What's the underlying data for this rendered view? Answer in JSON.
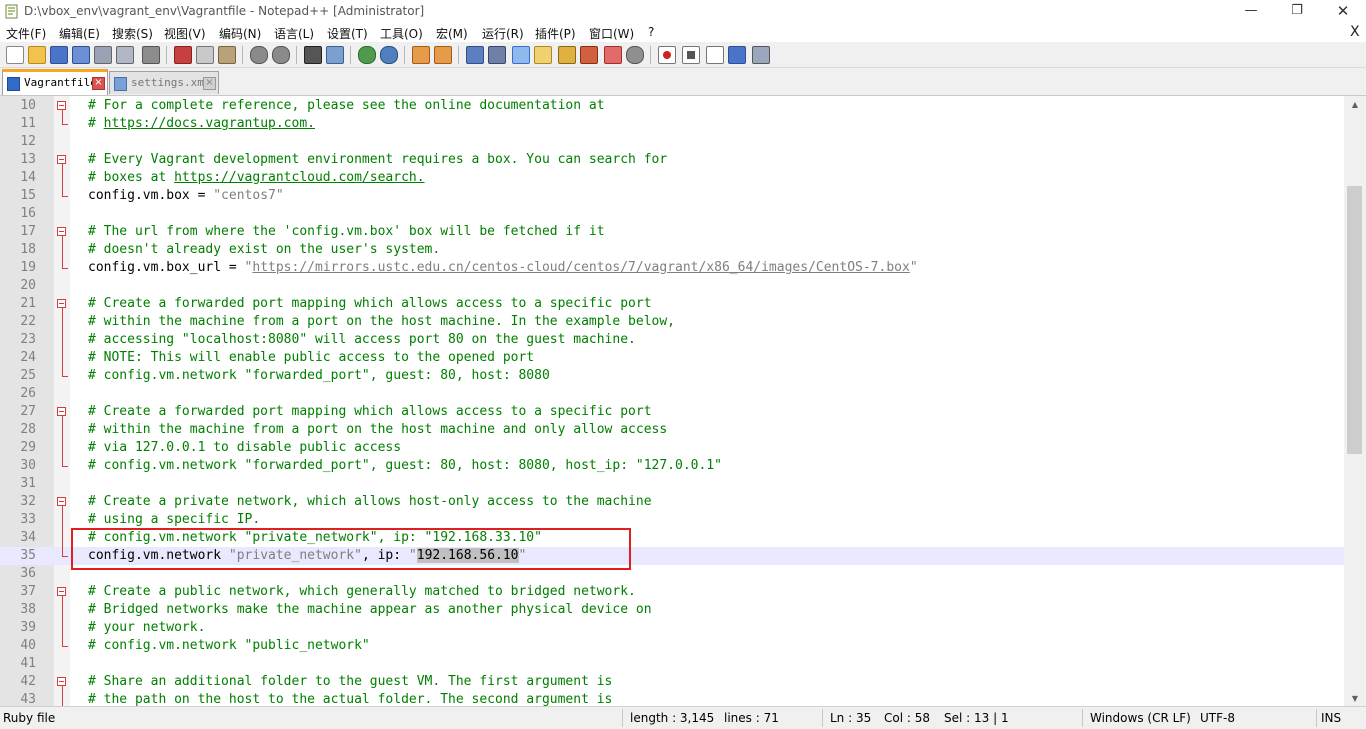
{
  "window": {
    "title": "D:\\vbox_env\\vagrant_env\\Vagrantfile - Notepad++ [Administrator]",
    "minimize_glyph": "—",
    "maximize_glyph": "❐",
    "close_glyph": "✕"
  },
  "menu": {
    "items": [
      "文件(F)",
      "编辑(E)",
      "搜索(S)",
      "视图(V)",
      "编码(N)",
      "语言(L)",
      "设置(T)",
      "工具(O)",
      "宏(M)",
      "运行(R)",
      "插件(P)",
      "窗口(W)",
      "?"
    ],
    "close_doc_glyph": "X"
  },
  "toolbar": {
    "icons": [
      "new-file-icon",
      "open-file-icon",
      "save-icon",
      "save-all-icon",
      "close-icon",
      "close-all-icon",
      "print-icon",
      "cut-icon",
      "copy-icon",
      "paste-icon",
      "undo-icon",
      "redo-icon",
      "find-icon",
      "replace-icon",
      "zoom-in-icon",
      "zoom-out-icon",
      "sync-vertical-icon",
      "sync-horizontal-icon",
      "word-wrap-icon",
      "show-all-chars-icon",
      "indent-guide-icon",
      "language-icon",
      "doc-map-icon",
      "function-list-icon",
      "folder-workspace-icon",
      "monitoring-icon",
      "record-macro-icon",
      "stop-macro-icon",
      "play-macro-icon",
      "run-macro-multiple-icon",
      "save-macro-icon"
    ]
  },
  "tabs": [
    {
      "label": "Vagrantfile",
      "active": true,
      "close_glyph": "×"
    },
    {
      "label": "settings.xml",
      "active": false,
      "close_glyph": "×"
    }
  ],
  "editor": {
    "lines": [
      {
        "n": "10",
        "segs": [
          {
            "t": "# For a complete reference, please see the online documentation at",
            "c": "cm"
          }
        ]
      },
      {
        "n": "11",
        "segs": [
          {
            "t": "# ",
            "c": "cm"
          },
          {
            "t": "https://docs.vagrantup.com.",
            "c": "url"
          }
        ]
      },
      {
        "n": "12",
        "segs": []
      },
      {
        "n": "13",
        "segs": [
          {
            "t": "# Every Vagrant development environment requires a box. You can search for",
            "c": "cm"
          }
        ]
      },
      {
        "n": "14",
        "segs": [
          {
            "t": "# boxes at ",
            "c": "cm"
          },
          {
            "t": "https://vagrantcloud.com/search.",
            "c": "url"
          }
        ]
      },
      {
        "n": "15",
        "segs": [
          {
            "t": "config.vm.box = ",
            "c": ""
          },
          {
            "t": "\"centos7\"",
            "c": "str"
          }
        ]
      },
      {
        "n": "16",
        "segs": []
      },
      {
        "n": "17",
        "segs": [
          {
            "t": "# The url from where the 'config.vm.box' box will be fetched if it",
            "c": "cm"
          }
        ]
      },
      {
        "n": "18",
        "segs": [
          {
            "t": "# doesn't already exist on the user's system.",
            "c": "cm"
          }
        ]
      },
      {
        "n": "19",
        "segs": [
          {
            "t": "config.vm.box_url = ",
            "c": ""
          },
          {
            "t": "\"",
            "c": "str"
          },
          {
            "t": "https://mirrors.ustc.edu.cn/centos-cloud/centos/7/vagrant/x86_64/images/CentOS-7.box",
            "c": "strurl"
          },
          {
            "t": "\"",
            "c": "str"
          }
        ]
      },
      {
        "n": "20",
        "segs": []
      },
      {
        "n": "21",
        "segs": [
          {
            "t": "# Create a forwarded port mapping which allows access to a specific port",
            "c": "cm"
          }
        ]
      },
      {
        "n": "22",
        "segs": [
          {
            "t": "# within the machine from a port on the host machine. In the example below,",
            "c": "cm"
          }
        ]
      },
      {
        "n": "23",
        "segs": [
          {
            "t": "# accessing \"localhost:8080\" will access port 80 on the guest machine.",
            "c": "cm"
          }
        ]
      },
      {
        "n": "24",
        "segs": [
          {
            "t": "# NOTE: This will enable public access to the opened port",
            "c": "cm"
          }
        ]
      },
      {
        "n": "25",
        "segs": [
          {
            "t": "# config.vm.network \"forwarded_port\", guest: 80, host: 8080",
            "c": "cm"
          }
        ]
      },
      {
        "n": "26",
        "segs": []
      },
      {
        "n": "27",
        "segs": [
          {
            "t": "# Create a forwarded port mapping which allows access to a specific port",
            "c": "cm"
          }
        ]
      },
      {
        "n": "28",
        "segs": [
          {
            "t": "# within the machine from a port on the host machine and only allow access",
            "c": "cm"
          }
        ]
      },
      {
        "n": "29",
        "segs": [
          {
            "t": "# via 127.0.0.1 to disable public access",
            "c": "cm"
          }
        ]
      },
      {
        "n": "30",
        "segs": [
          {
            "t": "# config.vm.network \"forwarded_port\", guest: 80, host: 8080, host_ip: \"127.0.0.1\"",
            "c": "cm"
          }
        ]
      },
      {
        "n": "31",
        "segs": []
      },
      {
        "n": "32",
        "segs": [
          {
            "t": "# Create a private network, which allows host-only access to the machine",
            "c": "cm"
          }
        ]
      },
      {
        "n": "33",
        "segs": [
          {
            "t": "# using a specific IP.",
            "c": "cm"
          }
        ]
      },
      {
        "n": "34",
        "segs": [
          {
            "t": "# config.vm.network \"private_network\", ip: \"192.168.33.10\"",
            "c": "cm"
          }
        ]
      },
      {
        "n": "35",
        "segs": [
          {
            "t": "config.vm.network ",
            "c": ""
          },
          {
            "t": "\"private_network\"",
            "c": "str"
          },
          {
            "t": ", ip: ",
            "c": ""
          },
          {
            "t": "\"",
            "c": "str"
          },
          {
            "t": "192.168.56.10",
            "c": "sel"
          },
          {
            "t": "\"",
            "c": "str"
          }
        ],
        "current": true
      },
      {
        "n": "36",
        "segs": []
      },
      {
        "n": "37",
        "segs": [
          {
            "t": "# Create a public network, which generally matched to bridged network.",
            "c": "cm"
          }
        ]
      },
      {
        "n": "38",
        "segs": [
          {
            "t": "# Bridged networks make the machine appear as another physical device on",
            "c": "cm"
          }
        ]
      },
      {
        "n": "39",
        "segs": [
          {
            "t": "# your network.",
            "c": "cm"
          }
        ]
      },
      {
        "n": "40",
        "segs": [
          {
            "t": "# config.vm.network \"public_network\"",
            "c": "cm"
          }
        ]
      },
      {
        "n": "41",
        "segs": []
      },
      {
        "n": "42",
        "segs": [
          {
            "t": "# Share an additional folder to the guest VM. The first argument is",
            "c": "cm"
          }
        ]
      },
      {
        "n": "43",
        "segs": [
          {
            "t": "# the path on the host to the actual folder. The second argument is",
            "c": "cm"
          }
        ]
      }
    ],
    "fold_starts": [
      "10",
      "13",
      "17",
      "21",
      "27",
      "32",
      "37",
      "42"
    ],
    "scroll_up_glyph": "▲",
    "scroll_down_glyph": "▼"
  },
  "status": {
    "file_type": "Ruby file",
    "length": "length : 3,145",
    "lines": "lines : 71",
    "ln": "Ln : 35",
    "col": "Col : 58",
    "sel": "Sel : 13 | 1",
    "eol": "Windows (CR LF)",
    "encoding": "UTF-8",
    "mode": "INS"
  },
  "colors": {
    "comment": "#007f00",
    "string": "#7f7f7f",
    "current_line": "#e8e8ff",
    "annotation_box": "#e02020",
    "active_tab_accent": "#f5a623"
  }
}
